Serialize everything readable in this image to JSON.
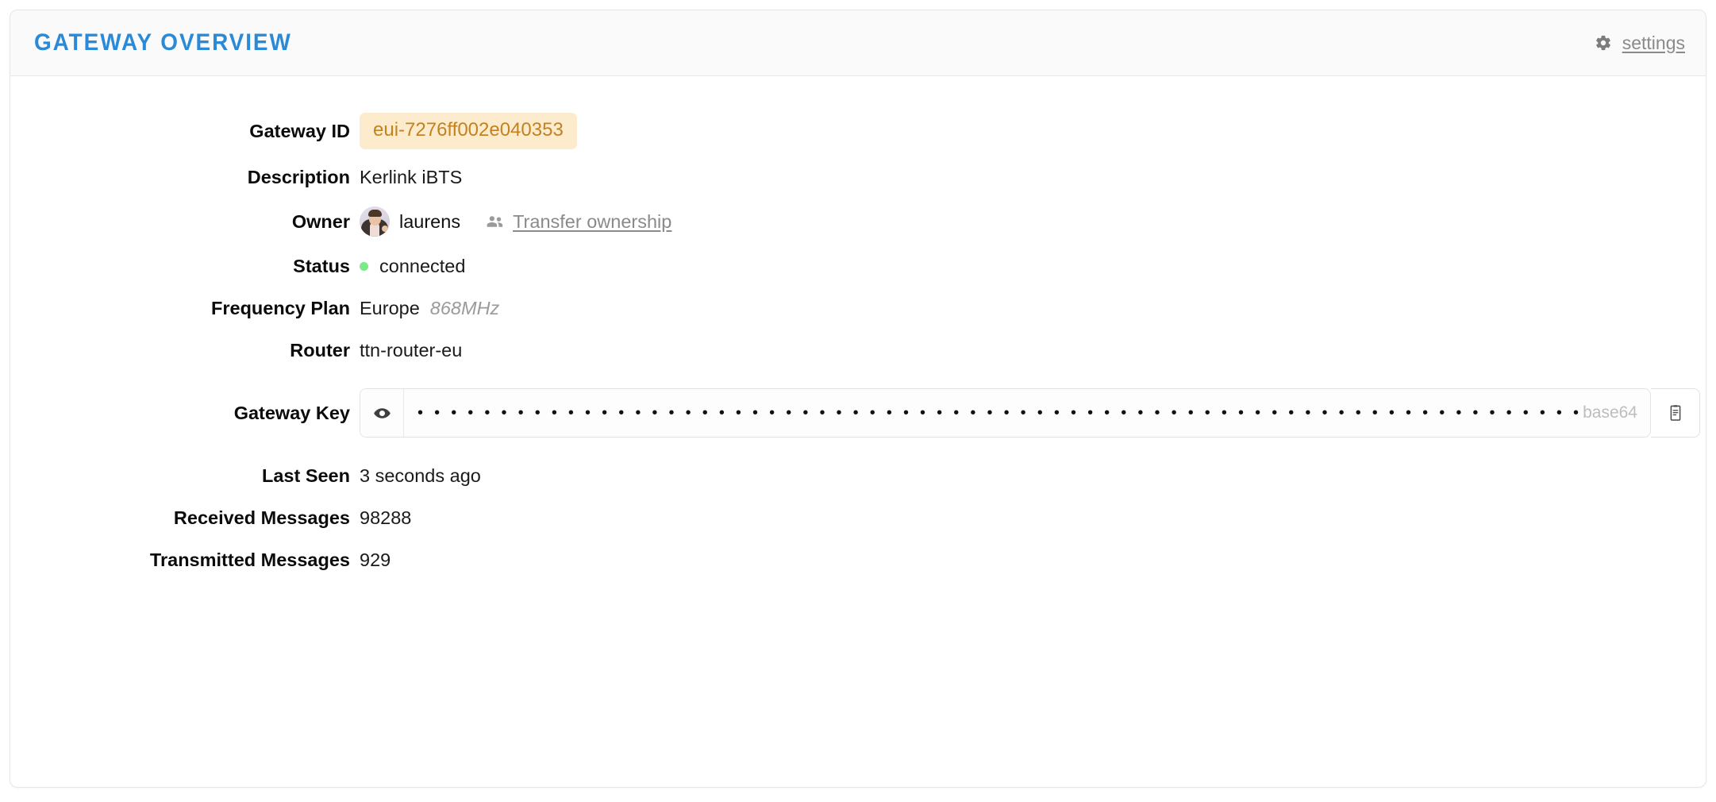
{
  "header": {
    "title": "GATEWAY OVERVIEW",
    "gear_icon": "gear-icon",
    "settings_label": "settings"
  },
  "fields": {
    "gateway_id": {
      "label": "Gateway ID",
      "value": "eui-7276ff002e040353"
    },
    "description": {
      "label": "Description",
      "value": "Kerlink iBTS"
    },
    "owner": {
      "label": "Owner",
      "name": "laurens",
      "avatar_icon": "user-avatar",
      "transfer_icon": "people-icon",
      "transfer_label": "Transfer ownership"
    },
    "status": {
      "label": "Status",
      "value": "connected",
      "dot_color": "#7de88a"
    },
    "frequency_plan": {
      "label": "Frequency Plan",
      "value": "Europe",
      "detail": "868MHz"
    },
    "router": {
      "label": "Router",
      "value": "ttn-router-eu"
    },
    "gateway_key": {
      "label": "Gateway Key",
      "masked_value": "•••••••••••••••••••••••••••••••••••••••••••••••••••••••••••••••••••••••••••••••••••••••••",
      "encoding": "base64",
      "eye_icon": "eye-icon",
      "copy_icon": "clipboard-copy-icon"
    },
    "last_seen": {
      "label": "Last Seen",
      "value": "3 seconds ago"
    },
    "received_messages": {
      "label": "Received Messages",
      "value": "98288"
    },
    "transmitted_messages": {
      "label": "Transmitted Messages",
      "value": "929"
    }
  },
  "colors": {
    "title_blue": "#2b8ad8",
    "pill_bg": "#fceccd",
    "pill_text": "#c4821f",
    "status_green": "#7de88a",
    "link_gray": "#8a8a8a"
  }
}
